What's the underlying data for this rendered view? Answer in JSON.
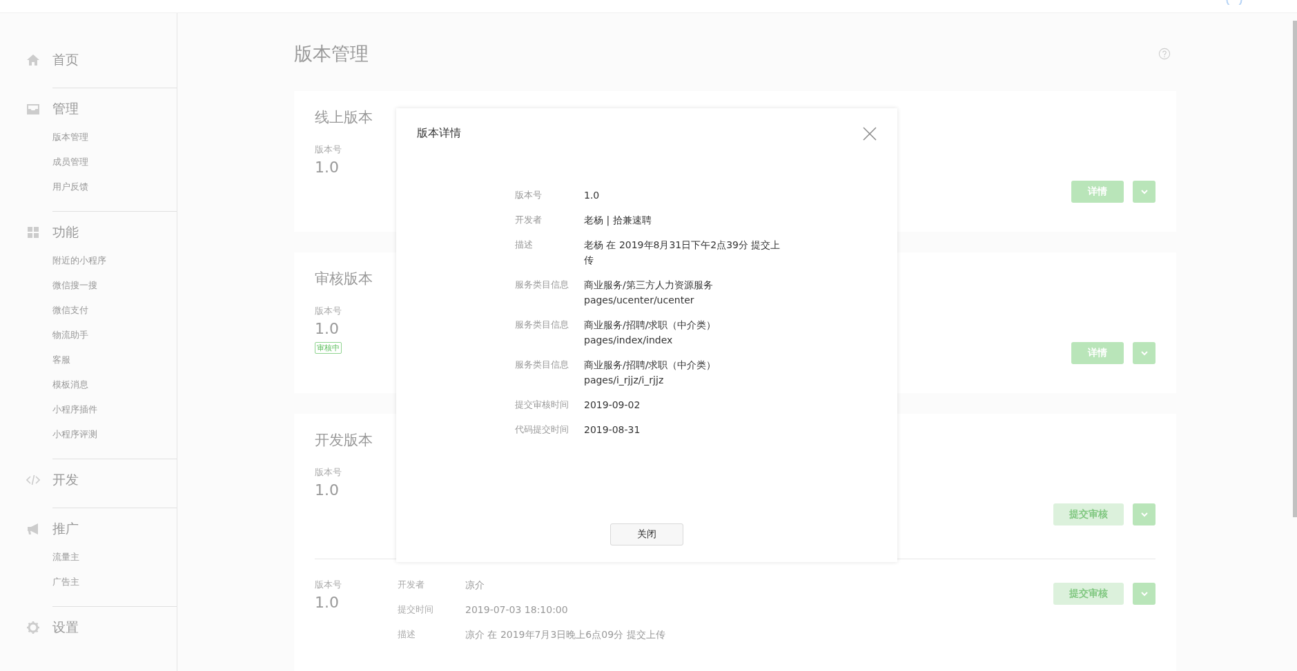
{
  "sidebar": {
    "groups": [
      {
        "kind": "home",
        "label": "首页"
      },
      {
        "kind": "inbox",
        "label": "管理",
        "items": [
          {
            "label": "版本管理"
          },
          {
            "label": "成员管理"
          },
          {
            "label": "用户反馈"
          }
        ]
      },
      {
        "kind": "grid",
        "label": "功能",
        "items": [
          {
            "label": "附近的小程序"
          },
          {
            "label": "微信搜一搜"
          },
          {
            "label": "微信支付"
          },
          {
            "label": "物流助手"
          },
          {
            "label": "客服"
          },
          {
            "label": "模板消息"
          },
          {
            "label": "小程序插件"
          },
          {
            "label": "小程序评测"
          }
        ]
      },
      {
        "kind": "code",
        "label": "开发"
      },
      {
        "kind": "megaphone",
        "label": "推广",
        "items": [
          {
            "label": "流量主"
          },
          {
            "label": "广告主"
          }
        ]
      },
      {
        "kind": "gear",
        "label": "设置"
      }
    ]
  },
  "page_title": "版本管理",
  "sections": [
    {
      "title": "线上版本",
      "versions": [
        {
          "version_label": "版本号",
          "version": "1.0",
          "button": {
            "label": "详情",
            "disabled": false
          }
        }
      ]
    },
    {
      "title": "审核版本",
      "versions": [
        {
          "version_label": "版本号",
          "version": "1.0",
          "tag": "审核中",
          "button": {
            "label": "详情",
            "disabled": false
          }
        }
      ]
    },
    {
      "title": "开发版本",
      "versions": [
        {
          "version_label": "版本号",
          "version": "1.0",
          "button": {
            "label": "提交审核",
            "disabled": true
          }
        },
        {
          "version_label": "版本号",
          "version": "1.0",
          "button": {
            "label": "提交审核",
            "disabled": true
          },
          "fields": [
            {
              "label": "开发者",
              "value": "凉介"
            },
            {
              "label": "提交时间",
              "value": "2019-07-03 18:10:00"
            },
            {
              "label": "描述",
              "value": "凉介 在 2019年7月3日晚上6点09分 提交上传"
            }
          ]
        }
      ]
    }
  ],
  "dialog": {
    "title": "版本详情",
    "rows": [
      {
        "label": "版本号",
        "lines": [
          "1.0"
        ]
      },
      {
        "label": "开发者",
        "lines": [
          "老杨 | 拾兼速聘"
        ]
      },
      {
        "label": "描述",
        "lines": [
          "老杨 在 2019年8月31日下午2点39分 提交上传"
        ]
      },
      {
        "label": "服务类目信息",
        "lines": [
          "商业服务/第三方人力资源服务",
          "pages/ucenter/ucenter"
        ]
      },
      {
        "label": "服务类目信息",
        "lines": [
          "商业服务/招聘/求职（中介类）",
          "pages/index/index"
        ]
      },
      {
        "label": "服务类目信息",
        "lines": [
          "商业服务/招聘/求职（中介类）",
          "pages/i_rjjz/i_rjjz"
        ]
      },
      {
        "label": "提交审核时间",
        "lines": [
          "2019-09-02"
        ]
      },
      {
        "label": "代码提交时间",
        "lines": [
          "2019-08-31"
        ]
      }
    ],
    "close_button": "关闭"
  }
}
